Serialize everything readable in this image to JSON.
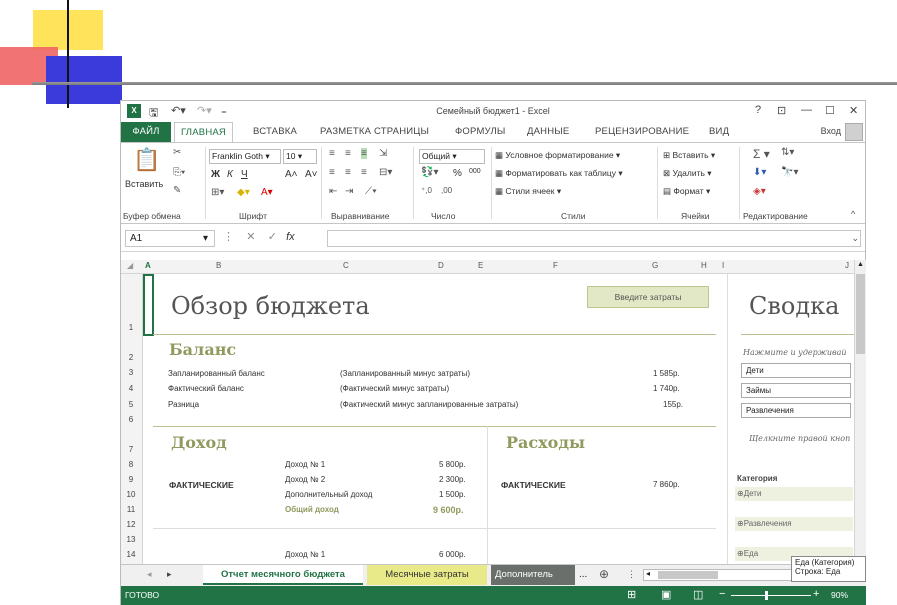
{
  "window": {
    "title": "Семейный бюджет1 - Excel",
    "help": "?",
    "ribbon_display": "⊡",
    "minimize": "—",
    "maximize": "☐",
    "close": "✕",
    "login": "Вход"
  },
  "qat": {
    "save": "🖫",
    "undo": "↶▾",
    "redo": "↷▾",
    "customize": "₌"
  },
  "tabs": [
    "ФАЙЛ",
    "ГЛАВНАЯ",
    "ВСТАВКА",
    "РАЗМЕТКА СТРАНИЦЫ",
    "ФОРМУЛЫ",
    "ДАННЫЕ",
    "РЕЦЕНЗИРОВАНИЕ",
    "ВИД"
  ],
  "ribbon": {
    "clipboard": {
      "label": "Буфер обмена",
      "paste": "Вставить"
    },
    "font": {
      "label": "Шрифт",
      "name": "Franklin Goth",
      "size": "10",
      "bold": "Ж",
      "italic": "К",
      "underline": "Ч",
      "grow": "A˄",
      "shrink": "A˅"
    },
    "alignment": {
      "label": "Выравнивание"
    },
    "number": {
      "label": "Число",
      "format": "Общий",
      "percent": "%",
      "thousands": "000"
    },
    "styles": {
      "label": "Стили",
      "conditional": "Условное форматирование",
      "as_table": "Форматировать как таблицу",
      "cell_styles": "Стили ячеек"
    },
    "cells": {
      "label": "Ячейки",
      "insert": "Вставить",
      "delete": "Удалить",
      "format": "Формат"
    },
    "editing": {
      "label": "Редактирование"
    }
  },
  "formula_bar": {
    "name_box": "A1",
    "fx": "fx",
    "value": ""
  },
  "columns": [
    "A",
    "B",
    "C",
    "D",
    "E",
    "F",
    "G",
    "H",
    "I",
    "J"
  ],
  "rows": [
    "1",
    "2",
    "3",
    "4",
    "5",
    "6",
    "7",
    "8",
    "9",
    "10",
    "11",
    "12",
    "13",
    "14"
  ],
  "sheet": {
    "title": "Обзор бюджета",
    "enter_costs_button": "Введите затраты",
    "balance": {
      "title": "Баланс",
      "rows": [
        {
          "name": "Запланированный баланс",
          "desc": "(Запланированный минус затраты)",
          "value": "1 585р."
        },
        {
          "name": "Фактический баланс",
          "desc": "(Фактический минус затраты)",
          "value": "1 740р."
        },
        {
          "name": "Разница",
          "desc": "(Фактический минус запланированные затраты)",
          "value": "155р."
        }
      ]
    },
    "income": {
      "title": "Доход",
      "actual_label": "ФАКТИЧЕСКИЕ",
      "items": [
        {
          "name": "Доход № 1",
          "value": "5 800р."
        },
        {
          "name": "Доход № 2",
          "value": "2 300р."
        },
        {
          "name": "Дополнительный доход",
          "value": "1 500р."
        }
      ],
      "total_label": "Общий доход",
      "total_value": "9 600р.",
      "next_item": {
        "name": "Доход № 1",
        "value": "6 000р."
      }
    },
    "expenses": {
      "title": "Расходы",
      "actual_label": "ФАКТИЧЕСКИЕ",
      "value": "7 860р."
    },
    "summary": {
      "title": "Сводка",
      "hint": "Нажмите и удерживай",
      "slicer_items": [
        "Дети",
        "Займы",
        "Развлечения"
      ],
      "right_click_hint": "Щелкните правой кноп",
      "category_header": "Категория",
      "categories": [
        "⊕Дети",
        "⊕Развлечения",
        "⊕Еда"
      ]
    }
  },
  "tooltip": {
    "line1": "Еда (Категория)",
    "line2": "Строка: Еда"
  },
  "sheet_tabs": [
    "Отчет месячного бюджета",
    "Месячные затраты",
    "Дополнитель"
  ],
  "sheet_tabs_more": "...",
  "status": {
    "ready": "ГОТОВО",
    "zoom": "90%"
  }
}
